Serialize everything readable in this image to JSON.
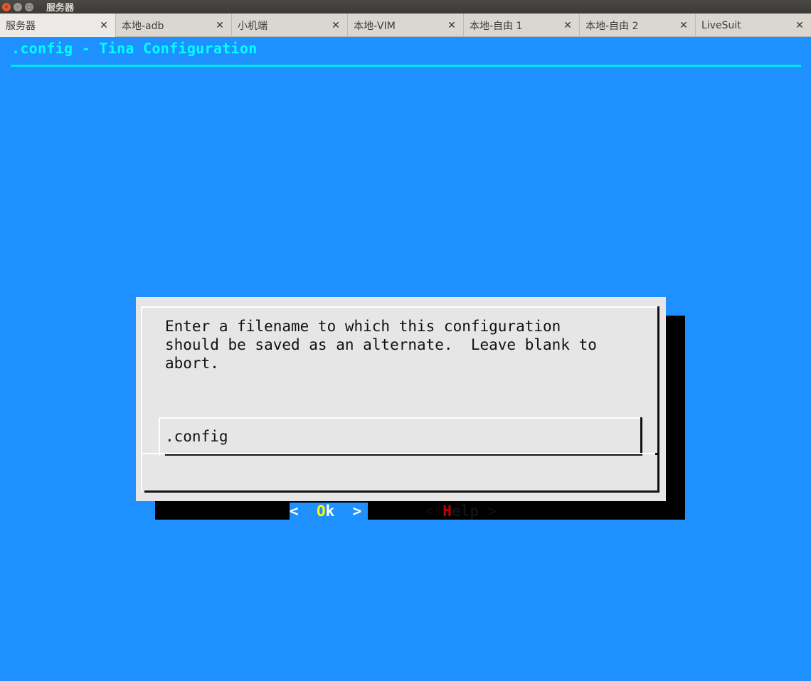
{
  "window": {
    "title": "服务器"
  },
  "tabs": [
    {
      "label": "服务器"
    },
    {
      "label": "本地-adb"
    },
    {
      "label": "小机端"
    },
    {
      "label": "本地-VIM"
    },
    {
      "label": "本地-自由 1"
    },
    {
      "label": "本地-自由 2"
    },
    {
      "label": "LiveSuit"
    }
  ],
  "terminal": {
    "header": ".config - Tina Configuration",
    "dialog": {
      "prompt": "Enter a filename to which this configuration\nshould be saved as an alternate.  Leave blank to\nabort.",
      "input_value": ".config",
      "ok": {
        "left": "<  ",
        "hot": "O",
        "rest": "k",
        "right": "  >"
      },
      "help": {
        "left": "< ",
        "hot": "H",
        "rest": "elp",
        "right": " >"
      }
    }
  },
  "colors": {
    "terminal_bg": "#1e90ff",
    "header_text": "#00ffff",
    "dialog_bg": "#e6e6e6",
    "hotkey_ok": "#ffff00",
    "hotkey_help": "#c00000"
  }
}
